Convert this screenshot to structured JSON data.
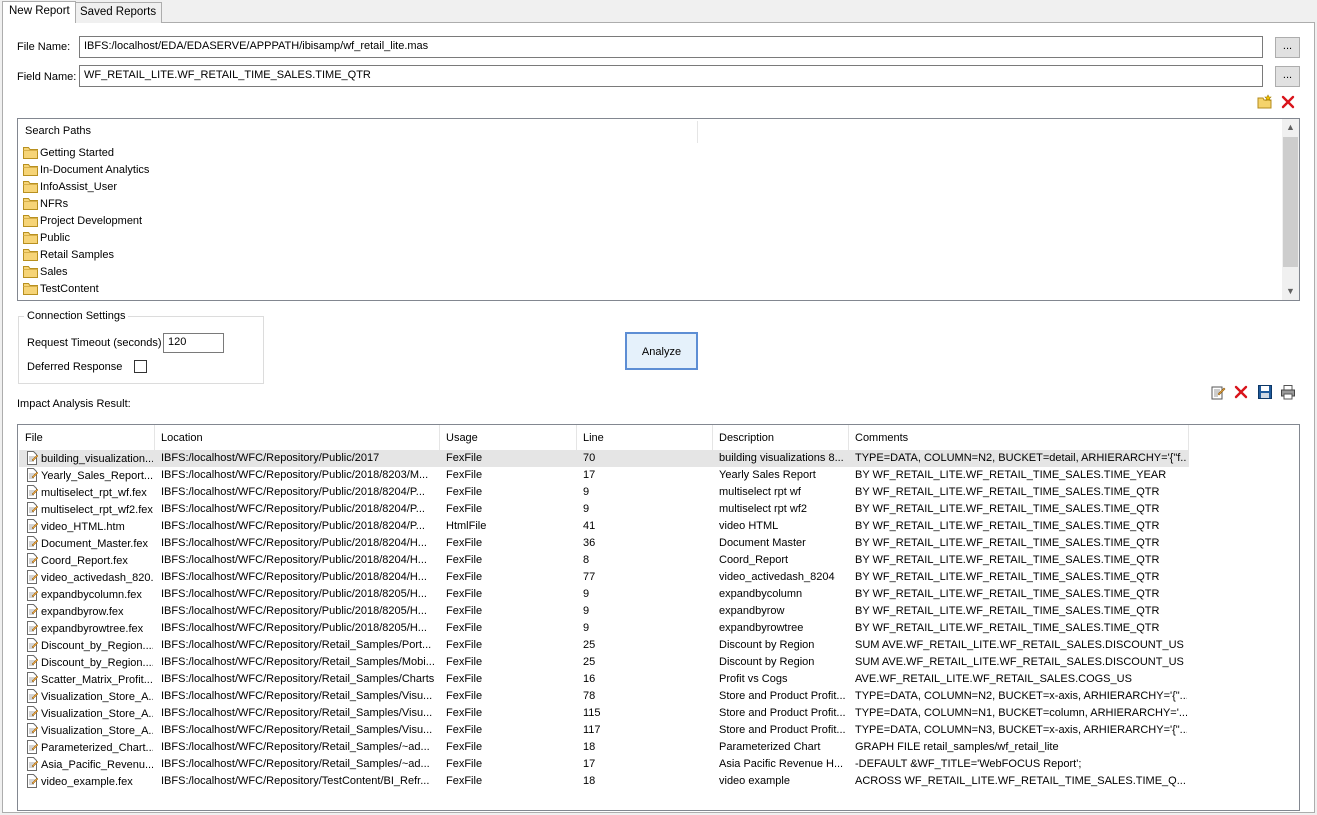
{
  "tabs": [
    "New Report",
    "Saved Reports"
  ],
  "file_name": {
    "label": "File Name:",
    "value": "IBFS:/localhost/EDA/EDASERVE/APPPATH/ibisamp/wf_retail_lite.mas",
    "browse": "..."
  },
  "field_name": {
    "label": "Field Name:",
    "value": "WF_RETAIL_LITE.WF_RETAIL_TIME_SALES.TIME_QTR",
    "browse": "..."
  },
  "search_paths": {
    "header": "Search Paths",
    "items": [
      "Getting Started",
      "In-Document Analytics",
      "InfoAssist_User",
      "NFRs",
      "Project Development",
      "Public",
      "Retail Samples",
      "Sales",
      "TestContent"
    ]
  },
  "connection": {
    "title": "Connection Settings",
    "timeout_label": "Request Timeout (seconds)",
    "timeout_value": "120",
    "deferred_label": "Deferred Response",
    "deferred_checked": false
  },
  "analyze_label": "Analyze",
  "result_label": "Impact Analysis Result:",
  "columns": [
    "File",
    "Location",
    "Usage",
    "Line",
    "Description",
    "Comments"
  ],
  "rows": [
    [
      "building_visualization...",
      "IBFS:/localhost/WFC/Repository/Public/2017",
      "FexFile",
      "70",
      "building visualizations 8...",
      "TYPE=DATA, COLUMN=N2, BUCKET=detail, ARHIERARCHY='{\"f..."
    ],
    [
      "Yearly_Sales_Report....",
      "IBFS:/localhost/WFC/Repository/Public/2018/8203/M...",
      "FexFile",
      "17",
      "Yearly Sales Report",
      "BY WF_RETAIL_LITE.WF_RETAIL_TIME_SALES.TIME_YEAR"
    ],
    [
      "multiselect_rpt_wf.fex",
      "IBFS:/localhost/WFC/Repository/Public/2018/8204/P...",
      "FexFile",
      "9",
      "multiselect rpt wf",
      "BY  WF_RETAIL_LITE.WF_RETAIL_TIME_SALES.TIME_QTR"
    ],
    [
      "multiselect_rpt_wf2.fex",
      "IBFS:/localhost/WFC/Repository/Public/2018/8204/P...",
      "FexFile",
      "9",
      "multiselect rpt wf2",
      "BY  WF_RETAIL_LITE.WF_RETAIL_TIME_SALES.TIME_QTR"
    ],
    [
      "video_HTML.htm",
      "IBFS:/localhost/WFC/Repository/Public/2018/8204/P...",
      "HtmlFile",
      "41",
      "video HTML",
      "BY  WF_RETAIL_LITE.WF_RETAIL_TIME_SALES.TIME_QTR"
    ],
    [
      "Document_Master.fex",
      "IBFS:/localhost/WFC/Repository/Public/2018/8204/H...",
      "FexFile",
      "36",
      "Document Master",
      "BY  WF_RETAIL_LITE.WF_RETAIL_TIME_SALES.TIME_QTR"
    ],
    [
      "Coord_Report.fex",
      "IBFS:/localhost/WFC/Repository/Public/2018/8204/H...",
      "FexFile",
      "8",
      "Coord_Report",
      "BY  WF_RETAIL_LITE.WF_RETAIL_TIME_SALES.TIME_QTR"
    ],
    [
      "video_activedash_820...",
      "IBFS:/localhost/WFC/Repository/Public/2018/8204/H...",
      "FexFile",
      "77",
      "video_activedash_8204",
      "BY WF_RETAIL_LITE.WF_RETAIL_TIME_SALES.TIME_QTR"
    ],
    [
      "expandbycolumn.fex",
      "IBFS:/localhost/WFC/Repository/Public/2018/8205/H...",
      "FexFile",
      "9",
      "expandbycolumn",
      "BY  WF_RETAIL_LITE.WF_RETAIL_TIME_SALES.TIME_QTR"
    ],
    [
      "expandbyrow.fex",
      "IBFS:/localhost/WFC/Repository/Public/2018/8205/H...",
      "FexFile",
      "9",
      "expandbyrow",
      "BY  WF_RETAIL_LITE.WF_RETAIL_TIME_SALES.TIME_QTR"
    ],
    [
      "expandbyrowtree.fex",
      "IBFS:/localhost/WFC/Repository/Public/2018/8205/H...",
      "FexFile",
      "9",
      "expandbyrowtree",
      "BY  WF_RETAIL_LITE.WF_RETAIL_TIME_SALES.TIME_QTR"
    ],
    [
      "Discount_by_Region....",
      "IBFS:/localhost/WFC/Repository/Retail_Samples/Port...",
      "FexFile",
      "25",
      "Discount by Region",
      "SUM AVE.WF_RETAIL_LITE.WF_RETAIL_SALES.DISCOUNT_US"
    ],
    [
      "Discount_by_Region....",
      "IBFS:/localhost/WFC/Repository/Retail_Samples/Mobi...",
      "FexFile",
      "25",
      "Discount by Region",
      "SUM AVE.WF_RETAIL_LITE.WF_RETAIL_SALES.DISCOUNT_US"
    ],
    [
      "Scatter_Matrix_Profit...",
      "IBFS:/localhost/WFC/Repository/Retail_Samples/Charts",
      "FexFile",
      "16",
      "Profit vs Cogs",
      "AVE.WF_RETAIL_LITE.WF_RETAIL_SALES.COGS_US"
    ],
    [
      "Visualization_Store_A...",
      "IBFS:/localhost/WFC/Repository/Retail_Samples/Visu...",
      "FexFile",
      "78",
      "Store and Product Profit...",
      "TYPE=DATA, COLUMN=N2, BUCKET=x-axis, ARHIERARCHY='{\"..."
    ],
    [
      "Visualization_Store_A...",
      "IBFS:/localhost/WFC/Repository/Retail_Samples/Visu...",
      "FexFile",
      "115",
      "Store and Product Profit...",
      "TYPE=DATA, COLUMN=N1, BUCKET=column, ARHIERARCHY='..."
    ],
    [
      "Visualization_Store_A...",
      "IBFS:/localhost/WFC/Repository/Retail_Samples/Visu...",
      "FexFile",
      "117",
      "Store and Product Profit...",
      "TYPE=DATA, COLUMN=N3, BUCKET=x-axis, ARHIERARCHY='{\"..."
    ],
    [
      "Parameterized_Chart....",
      "IBFS:/localhost/WFC/Repository/Retail_Samples/~ad...",
      "FexFile",
      "18",
      "Parameterized Chart",
      "GRAPH FILE retail_samples/wf_retail_lite"
    ],
    [
      "Asia_Pacific_Revenu...",
      "IBFS:/localhost/WFC/Repository/Retail_Samples/~ad...",
      "FexFile",
      "17",
      "Asia Pacific Revenue H...",
      "-DEFAULT &WF_TITLE='WebFOCUS Report';"
    ],
    [
      "video_example.fex",
      "IBFS:/localhost/WFC/Repository/TestContent/BI_Refr...",
      "FexFile",
      "18",
      "video example",
      "ACROSS WF_RETAIL_LITE.WF_RETAIL_TIME_SALES.TIME_Q..."
    ]
  ]
}
